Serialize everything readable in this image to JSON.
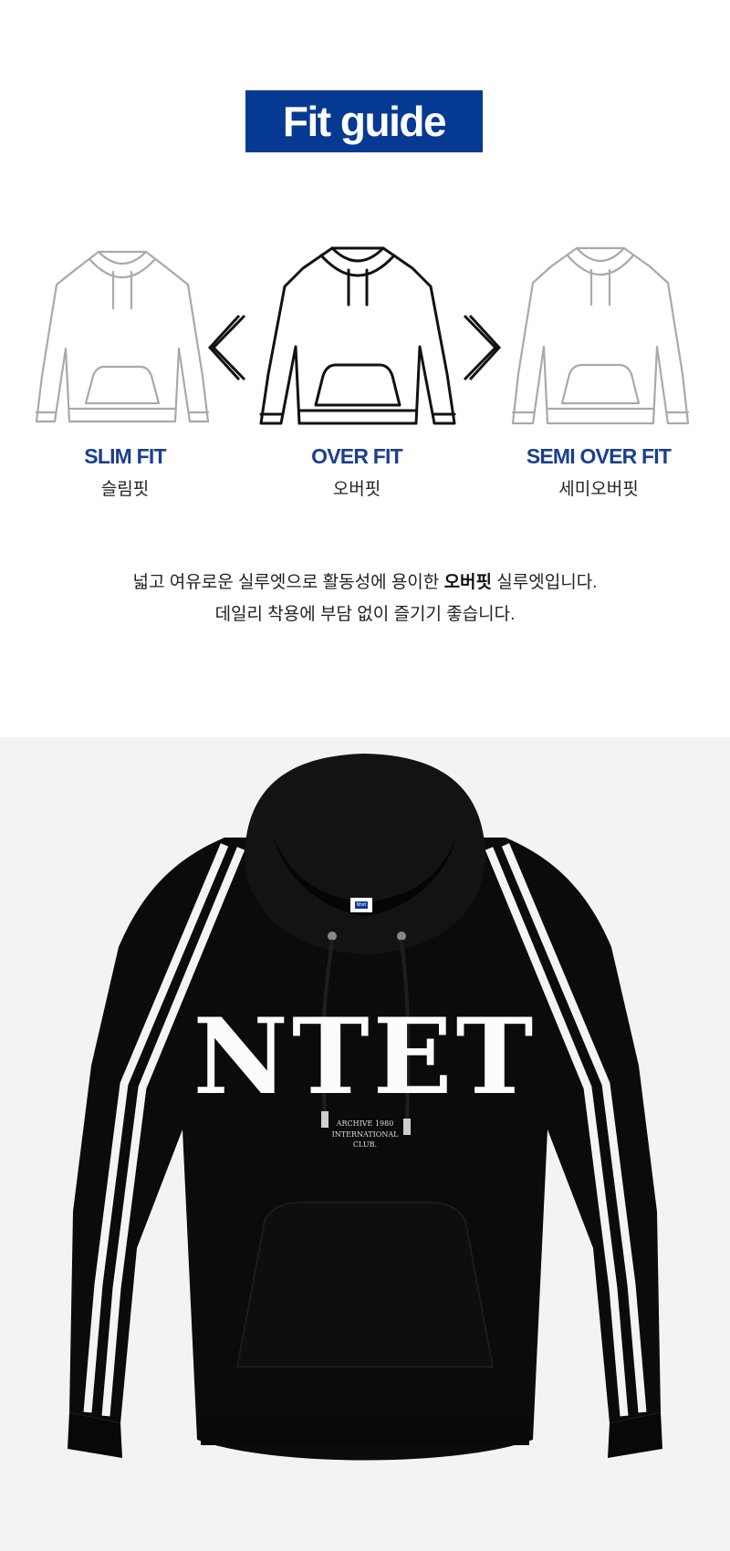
{
  "title": "Fit guide",
  "colors": {
    "brand_blue": "#063a92",
    "label_blue": "#1a3f8f"
  },
  "fits": [
    {
      "label": "SLIM FIT",
      "sub": "슬림핏",
      "selected": false
    },
    {
      "label": "OVER FIT",
      "sub": "오버핏",
      "selected": true
    },
    {
      "label": "SEMI OVER FIT",
      "sub": "세미오버핏",
      "selected": false
    }
  ],
  "icons": {
    "left_arrow": "chevron-left-icon",
    "right_arrow": "chevron-right-icon",
    "hoodie": "hoodie-icon"
  },
  "description": {
    "line1_prefix": "넓고 여유로운 실루엣으로 활동성에 용이한 ",
    "line1_bold": "오버핏",
    "line1_suffix": " 실루엣입니다.",
    "line2": "데일리 착용에 부담 없이 즐기기 좋습니다."
  },
  "product": {
    "print_main": "NTET",
    "print_sub": [
      "ARCHIVE 1980",
      "INTERNATIONAL",
      "CLUB."
    ],
    "tag": "Ntet",
    "color": "black"
  }
}
